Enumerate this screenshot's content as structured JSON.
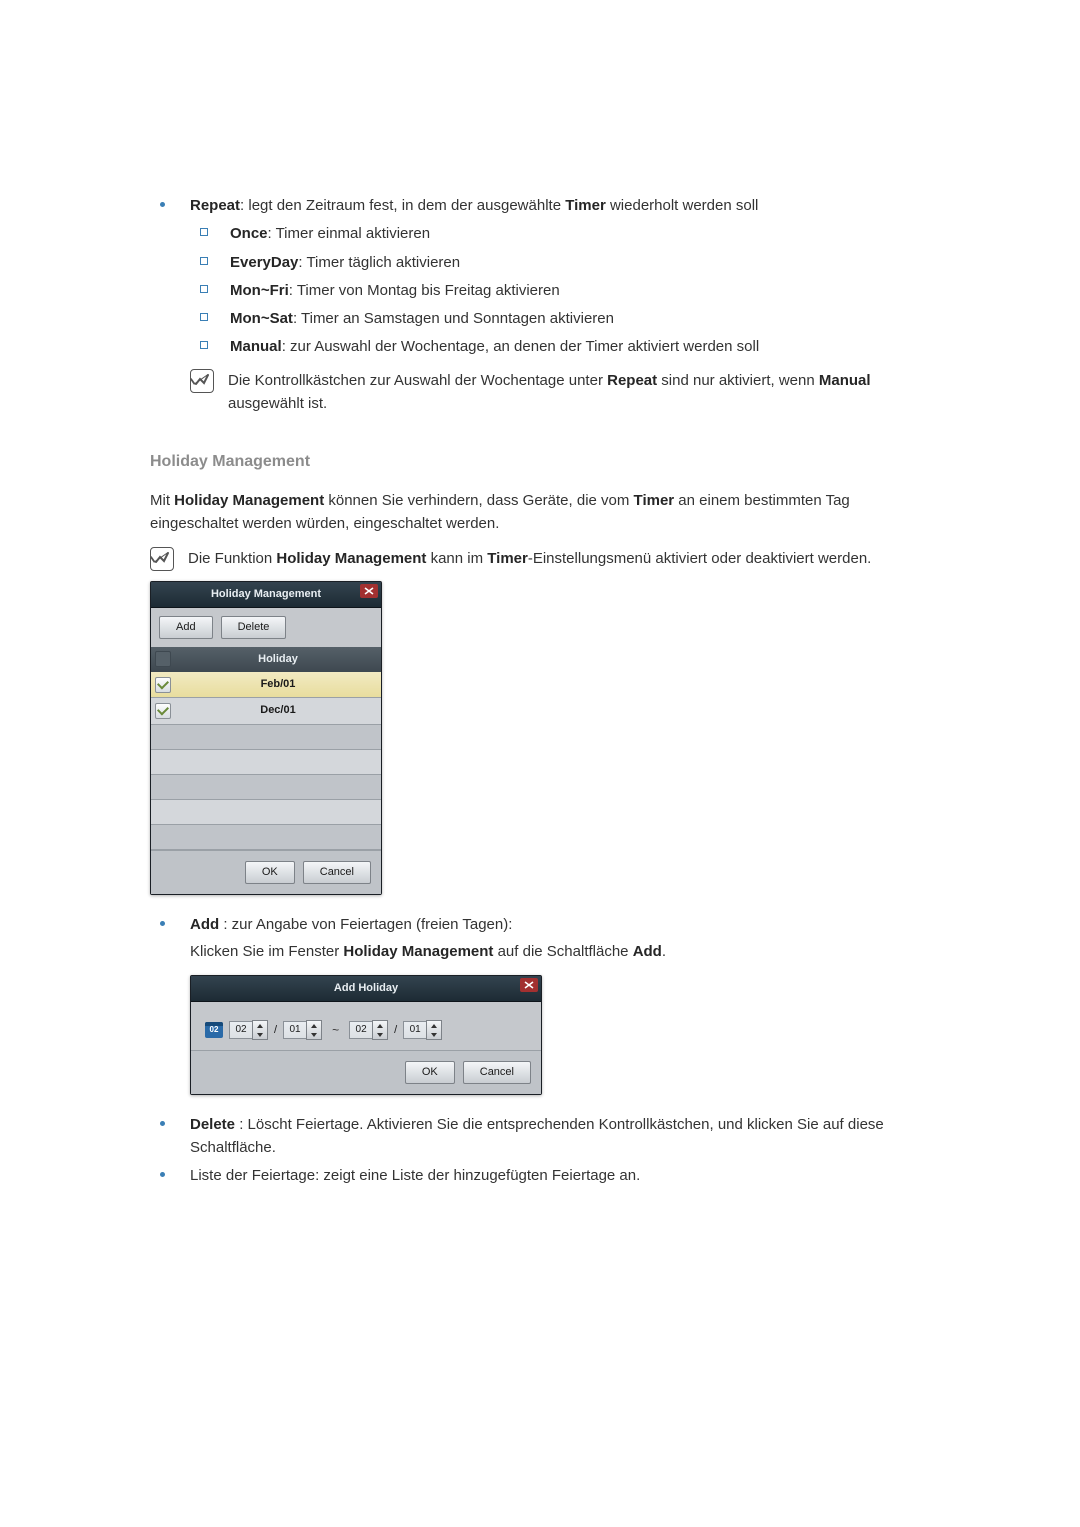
{
  "repeat": {
    "label": "Repeat",
    "desc": ": legt den Zeitraum fest, in dem der ausgewählte ",
    "ref": "Timer",
    "tail": " wiederholt werden soll",
    "items": [
      {
        "k": "Once",
        "v": ": Timer einmal aktivieren"
      },
      {
        "k": "EveryDay",
        "v": ": Timer täglich aktivieren"
      },
      {
        "k": "Mon~Fri",
        "v": ": Timer von Montag bis Freitag aktivieren"
      },
      {
        "k": "Mon~Sat",
        "v": ": Timer an Samstagen und Sonntagen aktivieren"
      },
      {
        "k": "Manual",
        "v": ": zur Auswahl der Wochentage, an denen der Timer aktiviert werden soll"
      }
    ],
    "note_a": "Die Kontrollkästchen zur Auswahl der Wochentage unter ",
    "note_b": "Repeat",
    "note_c": " sind nur aktiviert, wenn ",
    "note_d": "Manual",
    "note_e": " ausgewählt ist."
  },
  "hm": {
    "title": "Holiday Management",
    "p1a": "Mit ",
    "p1b": "Holiday Management",
    "p1c": " können Sie verhindern, dass Geräte, die vom ",
    "p1d": "Timer",
    "p1e": " an einem bestimmten Tag eingeschaltet werden würden, eingeschaltet werden.",
    "note_a": "Die Funktion ",
    "note_b": "Holiday Management",
    "note_c": " kann im ",
    "note_d": "Timer",
    "note_e": "-Einstellungsmenü aktiviert oder deaktiviert werden."
  },
  "dlg": {
    "title": "Holiday Management",
    "add": "Add",
    "delete": "Delete",
    "colHoliday": "Holiday",
    "rows": [
      {
        "checked": true,
        "v": "Feb/01",
        "sel": true
      },
      {
        "checked": true,
        "v": "Dec/01",
        "sel": false
      }
    ],
    "ok": "OK",
    "cancel": "Cancel"
  },
  "add": {
    "label": "Add ",
    "tail": ": zur Angabe von Feiertagen (freien Tagen):",
    "p_a": "Klicken Sie im Fenster ",
    "p_b": "Holiday Management",
    "p_c": " auf die Schaltfläche ",
    "p_d": "Add",
    "p_e": "."
  },
  "dlg2": {
    "title": "Add Holiday",
    "cal": "02",
    "m1": "02",
    "d1": "01",
    "m2": "02",
    "d2": "01",
    "sep": "/",
    "tilde": "~",
    "ok": "OK",
    "cancel": "Cancel"
  },
  "del": {
    "label": "Delete ",
    "tail": ": Löscht Feiertage. Aktivieren Sie die entsprechenden Kontrollkästchen, und klicken Sie auf diese Schaltfläche."
  },
  "listText": "Liste der Feiertage: zeigt eine Liste der hinzugefügten Feiertage an."
}
